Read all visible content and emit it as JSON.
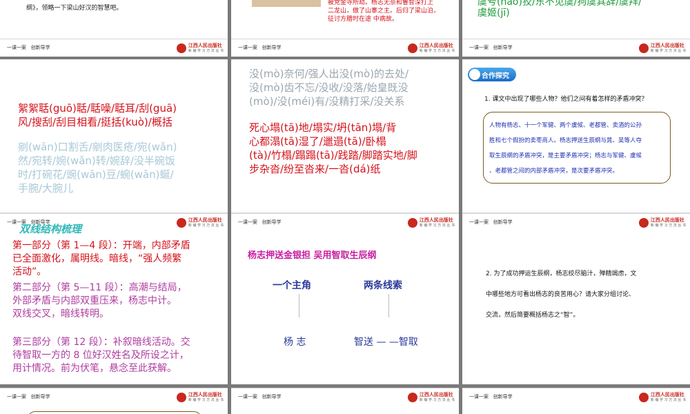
{
  "footer": {
    "series": "一课一案",
    "section": "创新导学",
    "publisher": "江西人民出版社",
    "publisher_sub": "新 编 学 习 方 法 丛 书"
  },
  "slide1": {
    "text": "纲》，领略一下梁山好汉的智慧吧。"
  },
  "slide2": {
    "lines": [
      "被党金寺所劫。杨志无奈和鲁智深打上",
      "二龙山，做了山寨之主。后归了梁山泊，",
      "征讨方腊时在途  中病故。"
    ]
  },
  "slide3": {
    "line1": "虞号(háo)狡/东不见虞/狗虞其辞/虞拜/",
    "line2": "虞姬(jī)"
  },
  "slide4": {
    "red_lines": [
      "絮絮聒(guō)聒/聒噪/聒耳/刮(guā)",
      "风/搜刮/刮目相看/挺括(kuò)/概括"
    ],
    "faded_lines": [
      "剜(wān)口割舌/剜肉医疮/宛(wǎn)",
      "然/宛转/婉(wǎn)转/婉辞/没半碗饭",
      "时/打碗花/豌(wān)豆/蜿(wān)蜒/",
      "手腕/大腕儿"
    ]
  },
  "slide5": {
    "faded_lines": [
      "没(mò)奈何/强人出没(mò)的去处/",
      "没(mò)齿不忘/没收/没落/始皇既没",
      "(mò)/没(méi)有/没精打采/没关系"
    ],
    "red_lines": [
      "死心塌(tā)地/塌实/坍(tān)塌/背",
      "心都溻(tā)湿了/邋遢(tā)/卧榻",
      "(tà)/竹榻/蹋蹋(tā)/践踏/脚踏实地/脚",
      "步杂沓/纷至沓来/一沓(dá)纸"
    ]
  },
  "slide6": {
    "badge": "合作探究",
    "question": "1. 课文中出现了哪些人物？他们之间有着怎样的矛盾冲突？",
    "answer_lines": [
      "人物有杨志、十一个军健、两个虞候、老都管、卖酒的公孙",
      "胜和七个假扮的卖枣商人。杨志押送生辰纲与晁、吴等人夺",
      "取生辰纲的矛盾冲突，是主要矛盾冲突；杨志与军健、虞候",
      "、老都管之间的内部矛盾冲突，是次要矛盾冲突。"
    ]
  },
  "slide7": {
    "title": "双线结构梳理",
    "part1_lines": [
      "第一部分（第 1—4 段）：开端，内部矛盾",
      "已全面激化，属明线。暗线，“强人频繁",
      "活动”。"
    ],
    "part2_lines": [
      "第二部分（第 5—11 段）：高潮与结局，",
      "外部矛盾与内部双重压来，杨志中计。",
      "双线交叉，暗线转明。"
    ],
    "part3_lines": [
      "第三部分（第 12 段）：补叙暗线活动。交",
      "待智取一方的 8 位好汉姓名及所设之计，",
      "用计情况。前为伏笔，悬念至此获解。"
    ]
  },
  "slide8": {
    "title": "杨志押送金银担  吴用智取生辰纲",
    "left_head": "一个主角",
    "right_head": "两条线索",
    "left_foot": "杨   志",
    "right_foot": "智送 — —智取"
  },
  "slide9": {
    "lines": [
      "2. 为了成功押运生辰纲，杨志绞尽脑汁，殚精竭虑，文",
      "中哪些地方可看出杨志的良苦用心？请大家分组讨论、",
      "交流，然后简要概括杨志之“智”。"
    ]
  },
  "colors": {
    "red": "#d4121b",
    "faded": "#a8c8d8",
    "teal": "#30b8b8",
    "purple": "#b03ca0",
    "magenta": "#c81ea0",
    "blue": "#2a3a9a"
  }
}
